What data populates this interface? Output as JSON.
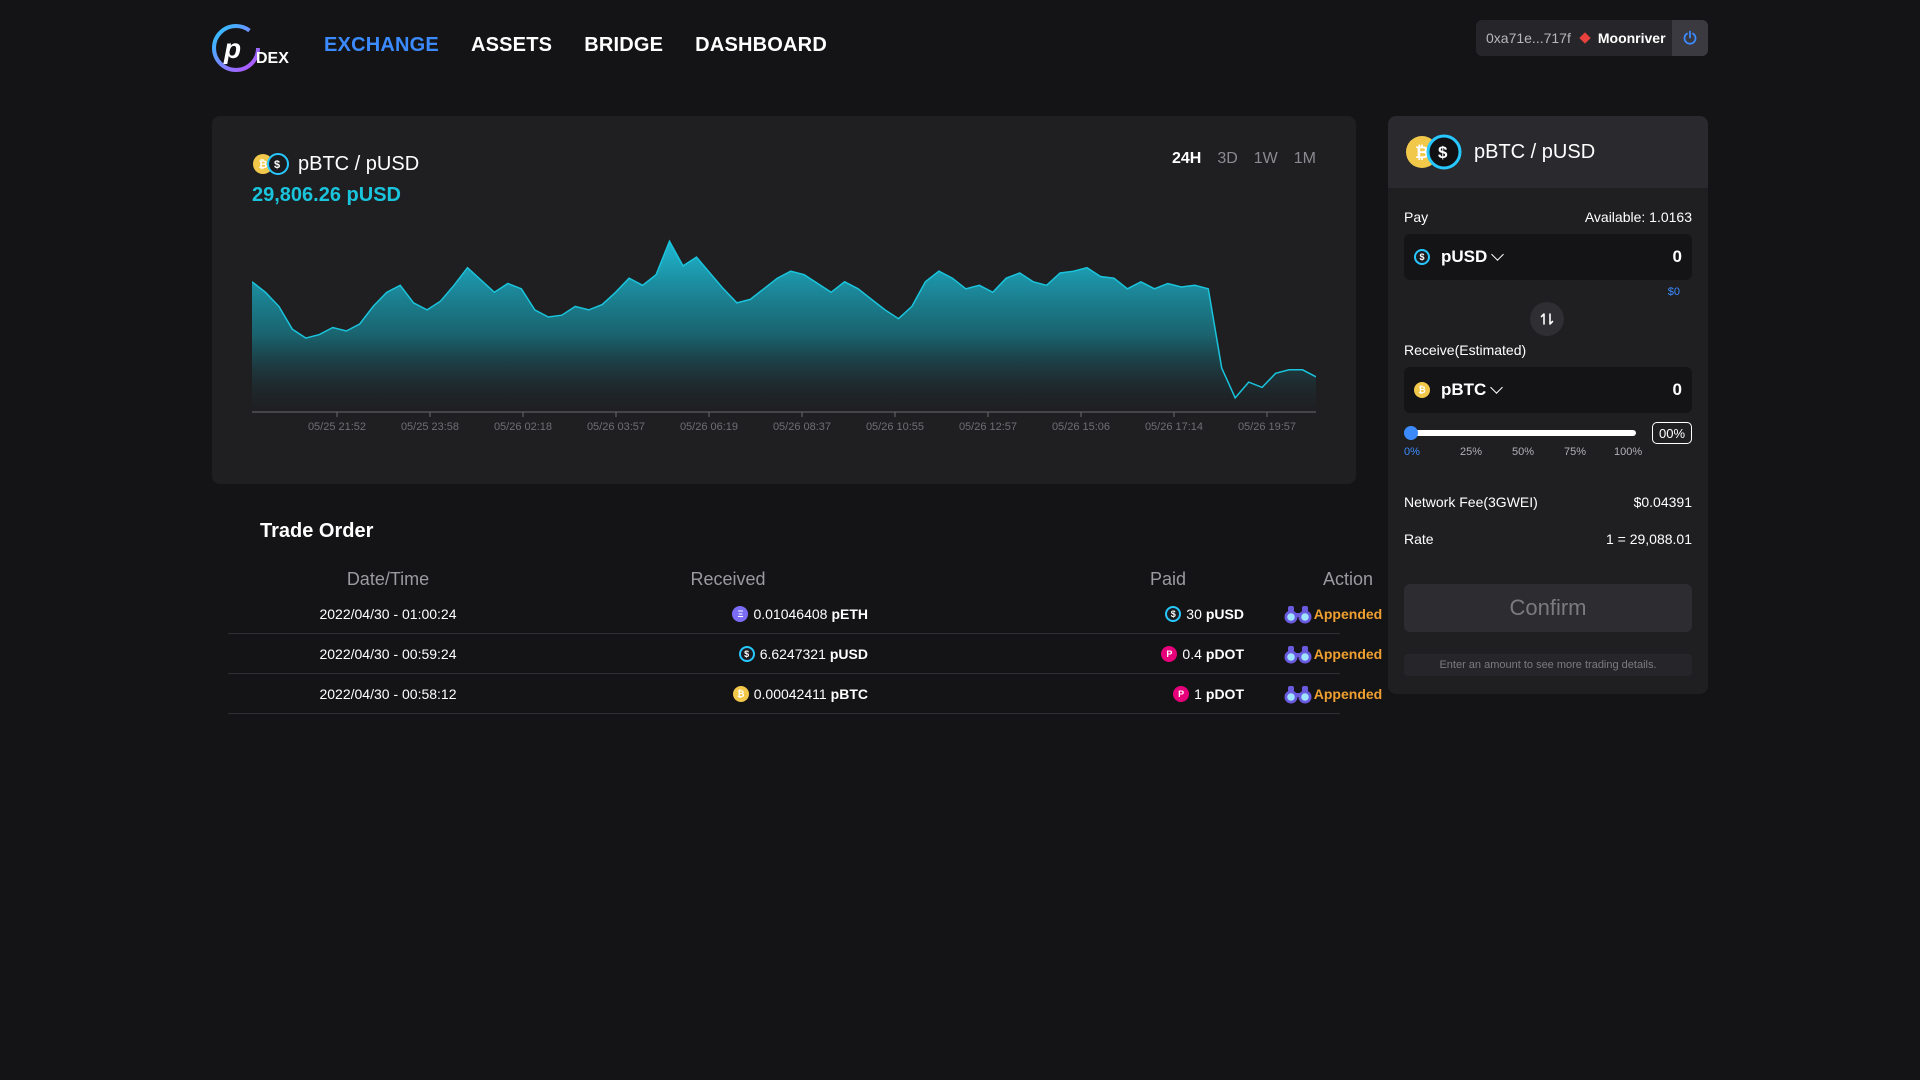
{
  "header": {
    "logo_text": "DEX",
    "nav": [
      {
        "label": "EXCHANGE",
        "active": true
      },
      {
        "label": "ASSETS",
        "active": false
      },
      {
        "label": "BRIDGE",
        "active": false
      },
      {
        "label": "DASHBOARD",
        "active": false
      }
    ],
    "wallet": {
      "address": "0xa71e...717f",
      "network": "Moonriver"
    }
  },
  "chart_panel": {
    "pair": "pBTC / pUSD",
    "price": "29,806.26 pUSD",
    "ranges": [
      {
        "label": "24H",
        "active": true
      },
      {
        "label": "3D",
        "active": false
      },
      {
        "label": "1W",
        "active": false
      },
      {
        "label": "1M",
        "active": false
      }
    ]
  },
  "chart_data": {
    "type": "area",
    "x_ticks": [
      "05/25 21:52",
      "05/25 23:58",
      "05/26 02:18",
      "05/26 03:57",
      "05/26 06:19",
      "05/26 08:37",
      "05/26 10:55",
      "05/26 12:57",
      "05/26 15:06",
      "05/26 17:14",
      "05/26 19:57"
    ],
    "values": [
      0.74,
      0.68,
      0.6,
      0.47,
      0.42,
      0.44,
      0.48,
      0.46,
      0.5,
      0.6,
      0.68,
      0.72,
      0.62,
      0.58,
      0.63,
      0.72,
      0.82,
      0.75,
      0.68,
      0.73,
      0.7,
      0.58,
      0.54,
      0.55,
      0.6,
      0.58,
      0.61,
      0.68,
      0.76,
      0.72,
      0.78,
      0.97,
      0.83,
      0.88,
      0.79,
      0.7,
      0.62,
      0.64,
      0.7,
      0.76,
      0.8,
      0.78,
      0.73,
      0.68,
      0.74,
      0.7,
      0.64,
      0.58,
      0.53,
      0.6,
      0.74,
      0.8,
      0.76,
      0.7,
      0.72,
      0.68,
      0.76,
      0.79,
      0.74,
      0.72,
      0.79,
      0.8,
      0.82,
      0.77,
      0.76,
      0.7,
      0.74,
      0.7,
      0.73,
      0.71,
      0.72,
      0.7,
      0.25,
      0.08,
      0.17,
      0.14,
      0.22,
      0.24,
      0.24,
      0.2
    ],
    "area_color": "#1fb8d2",
    "line_color": "#19c4dc"
  },
  "trade_order": {
    "title": "Trade Order",
    "headers": [
      "Date/Time",
      "Received",
      "Paid",
      "Action"
    ],
    "rows": [
      {
        "datetime": "2022/04/30 - 01:00:24",
        "received_amount": "0.01046408",
        "received_token": "pETH",
        "received_icon": "eth-icon",
        "paid_amount": "30",
        "paid_token": "pUSD",
        "paid_icon": "usd-icon",
        "action": "Appended"
      },
      {
        "datetime": "2022/04/30 - 00:59:24",
        "received_amount": "6.6247321",
        "received_token": "pUSD",
        "received_icon": "usd-icon",
        "paid_amount": "0.4",
        "paid_token": "pDOT",
        "paid_icon": "dot-icon",
        "action": "Appended"
      },
      {
        "datetime": "2022/04/30 - 00:58:12",
        "received_amount": "0.00042411",
        "received_token": "pBTC",
        "received_icon": "btc-icon",
        "paid_amount": "1",
        "paid_token": "pDOT",
        "paid_icon": "dot-icon",
        "action": "Appended"
      }
    ]
  },
  "swap": {
    "pair": "pBTC / pUSD",
    "pay_label": "Pay",
    "available": "Available: 1.0163",
    "pay_token": "pUSD",
    "pay_amount": "0",
    "pay_usd": "$0",
    "receive_label": "Receive(Estimated)",
    "receive_token": "pBTC",
    "receive_amount": "0",
    "slider_percent": "00%",
    "slider_value": 0,
    "slider_ticks": [
      "0%",
      "25%",
      "50%",
      "75%",
      "100%"
    ],
    "network_fee_label": "Network Fee(3GWEI)",
    "network_fee_value": "$0.04391",
    "rate_label": "Rate",
    "rate_value": "1 = 29,088.01",
    "confirm_label": "Confirm",
    "hint": "Enter an amount to see more trading details."
  },
  "colors": {
    "accent": "#3b8bff",
    "price": "#19c4dc",
    "appended": "#f0a030",
    "background": "#141416",
    "panel": "#1f1f22"
  }
}
